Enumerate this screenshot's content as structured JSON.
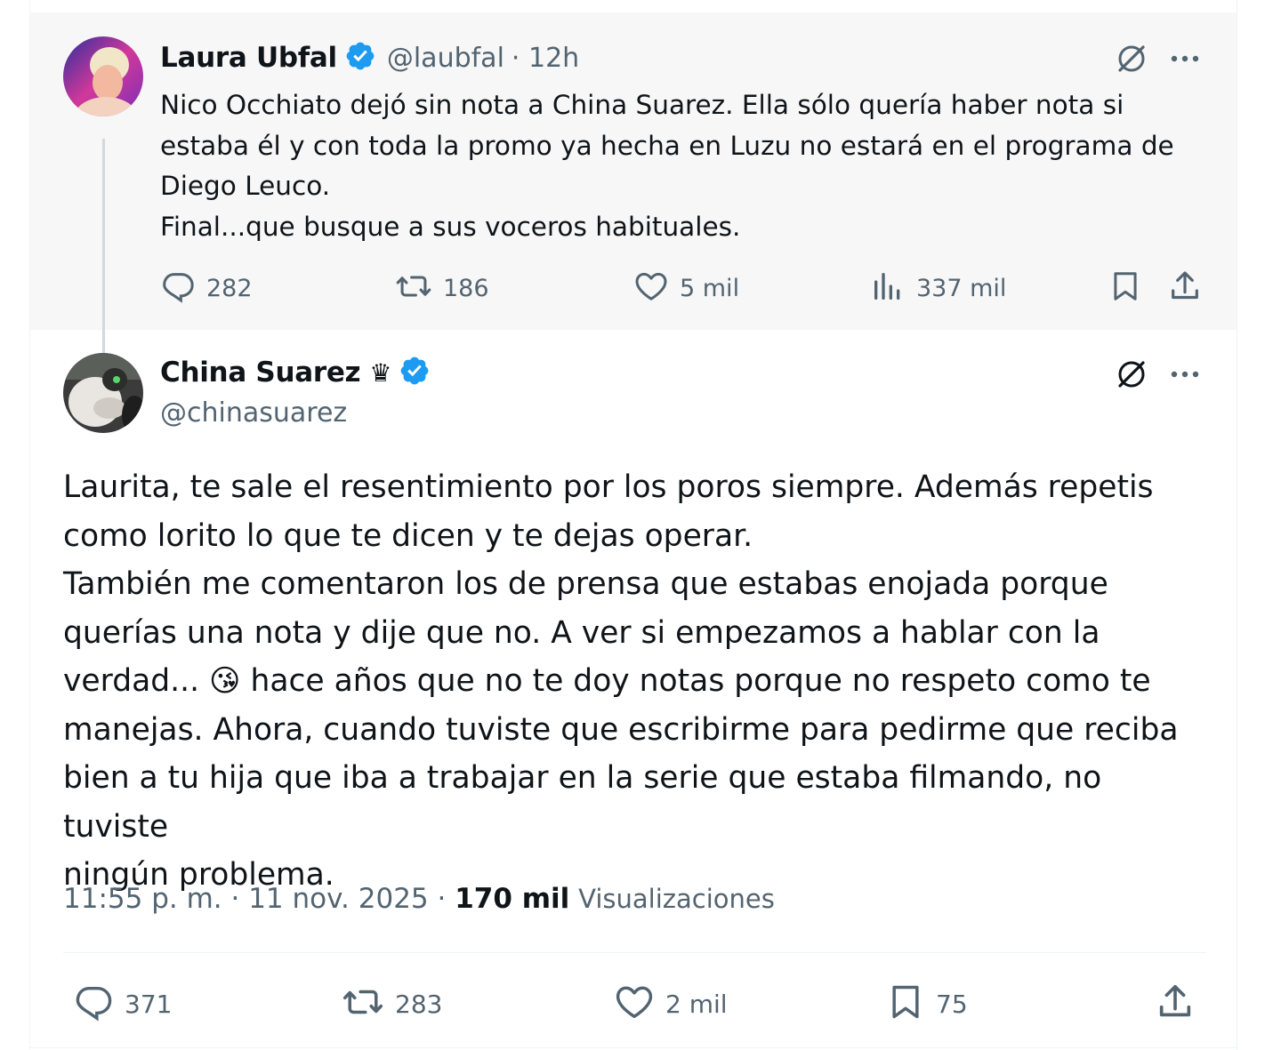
{
  "colors": {
    "verified": "#1d9bf0",
    "secondary_text": "#536471",
    "primary_text": "#0f1419",
    "parent_bg": "#f7f7f7"
  },
  "parent_tweet": {
    "author_name": "Laura Ubfal",
    "author_handle": "@laubfal",
    "time": "· 12h",
    "text": "Nico Occhiato dejó sin nota a China Suarez. Ella sólo quería haber nota si\nestaba él y con toda la promo ya hecha en Luzu no estará en el programa de\nDiego Leuco.\nFinal...que busque a sus voceros habituales.",
    "replies": "282",
    "reposts": "186",
    "likes": "5 mil",
    "views": "337 mil"
  },
  "main_tweet": {
    "author_name": "China Suarez",
    "crown": "♛",
    "author_handle": "@chinasuarez",
    "text_1": "Laurita, te sale el resentimiento por los poros siempre. Además repetis\ncomo lorito lo que te dicen y te dejas operar.\nTambién me comentaron los de prensa que estabas enojada porque\nquerías una nota y dije que no. A ver si empezamos a hablar con la\nverdad... ",
    "emoji": "😘",
    "text_2": " hace años que no te doy notas porque no respeto como te\nmanejas. Ahora, cuando tuviste que escribirme para pedirme que reciba\nbien a tu hija que iba a trabajar en la serie que estaba filmando, no tuviste\nningún problema.",
    "timestamp": "11:55 p. m. · 11 nov. 2025 ·",
    "views_count": "170 mil",
    "views_label": "Visualizaciones",
    "replies": "371",
    "reposts": "283",
    "likes": "2 mil",
    "bookmarks": "75"
  },
  "icons": [
    "verified-badge-icon",
    "grok-icon",
    "more-icon",
    "reply-icon",
    "repost-icon",
    "like-icon",
    "views-icon",
    "bookmark-icon",
    "share-icon"
  ]
}
